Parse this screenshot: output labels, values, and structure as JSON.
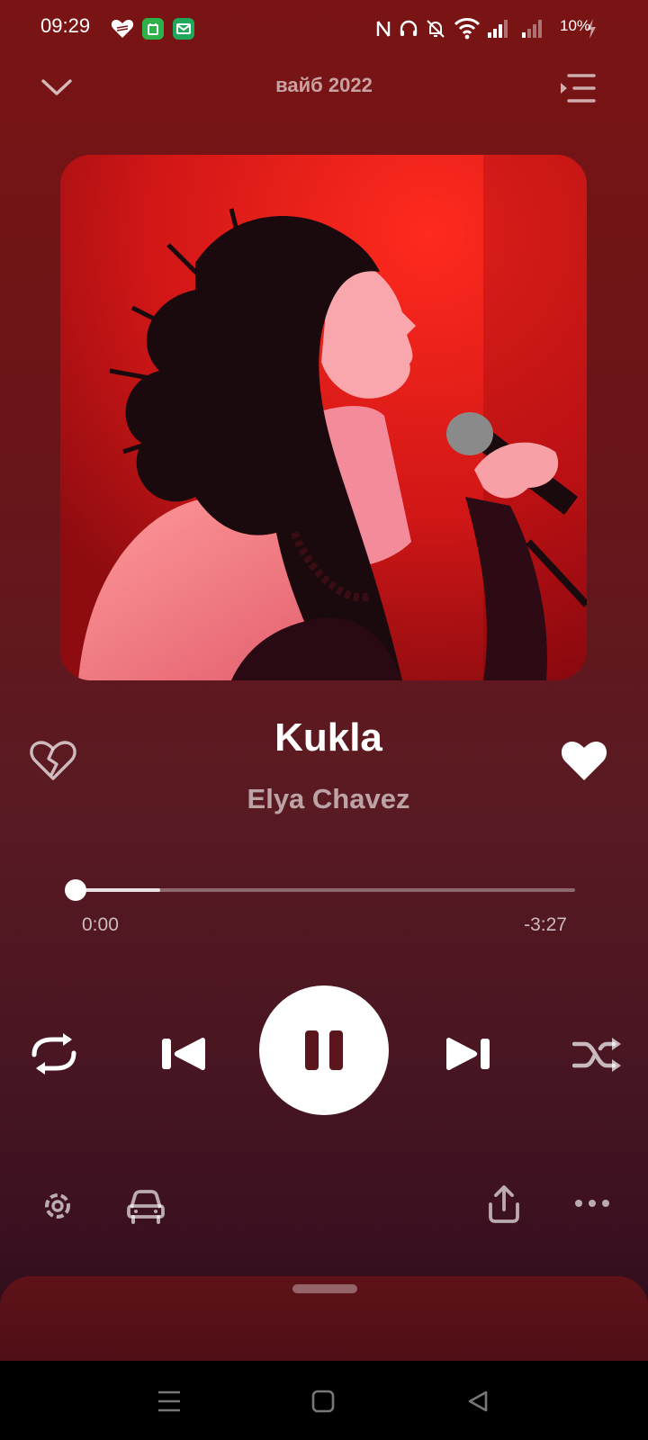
{
  "status_bar": {
    "time": "09:29",
    "battery": "10%",
    "app_icons": [
      {
        "name": "heart-app-icon",
        "color": "#ffffff"
      },
      {
        "name": "shop-app-icon",
        "color": "#2fb24c"
      },
      {
        "name": "mail-app-icon",
        "color": "#1fa85a"
      }
    ],
    "indicators": [
      "nfc-icon",
      "headphones-icon",
      "mute-icon",
      "wifi-icon",
      "signal-icon",
      "signal-icon",
      "battery-charging-icon"
    ]
  },
  "header": {
    "title": "вайб 2022"
  },
  "track": {
    "title": "Kukla",
    "artist": "Elya Chavez"
  },
  "progress": {
    "elapsed": "0:00",
    "remaining": "-3:27",
    "position_fraction": 0.0,
    "buffered_fraction": 0.17
  },
  "colors": {
    "background_top": "#7a1414",
    "background_bottom": "#2a0b18",
    "accent": "#ffffff"
  },
  "controls": [
    "repeat-icon",
    "previous-icon",
    "pause-icon",
    "next-icon",
    "shuffle-icon"
  ],
  "bottom_actions": [
    "settings-icon",
    "car-mode-icon",
    "share-icon",
    "more-icon"
  ],
  "nav": [
    "menu-icon",
    "home-icon",
    "back-icon"
  ]
}
